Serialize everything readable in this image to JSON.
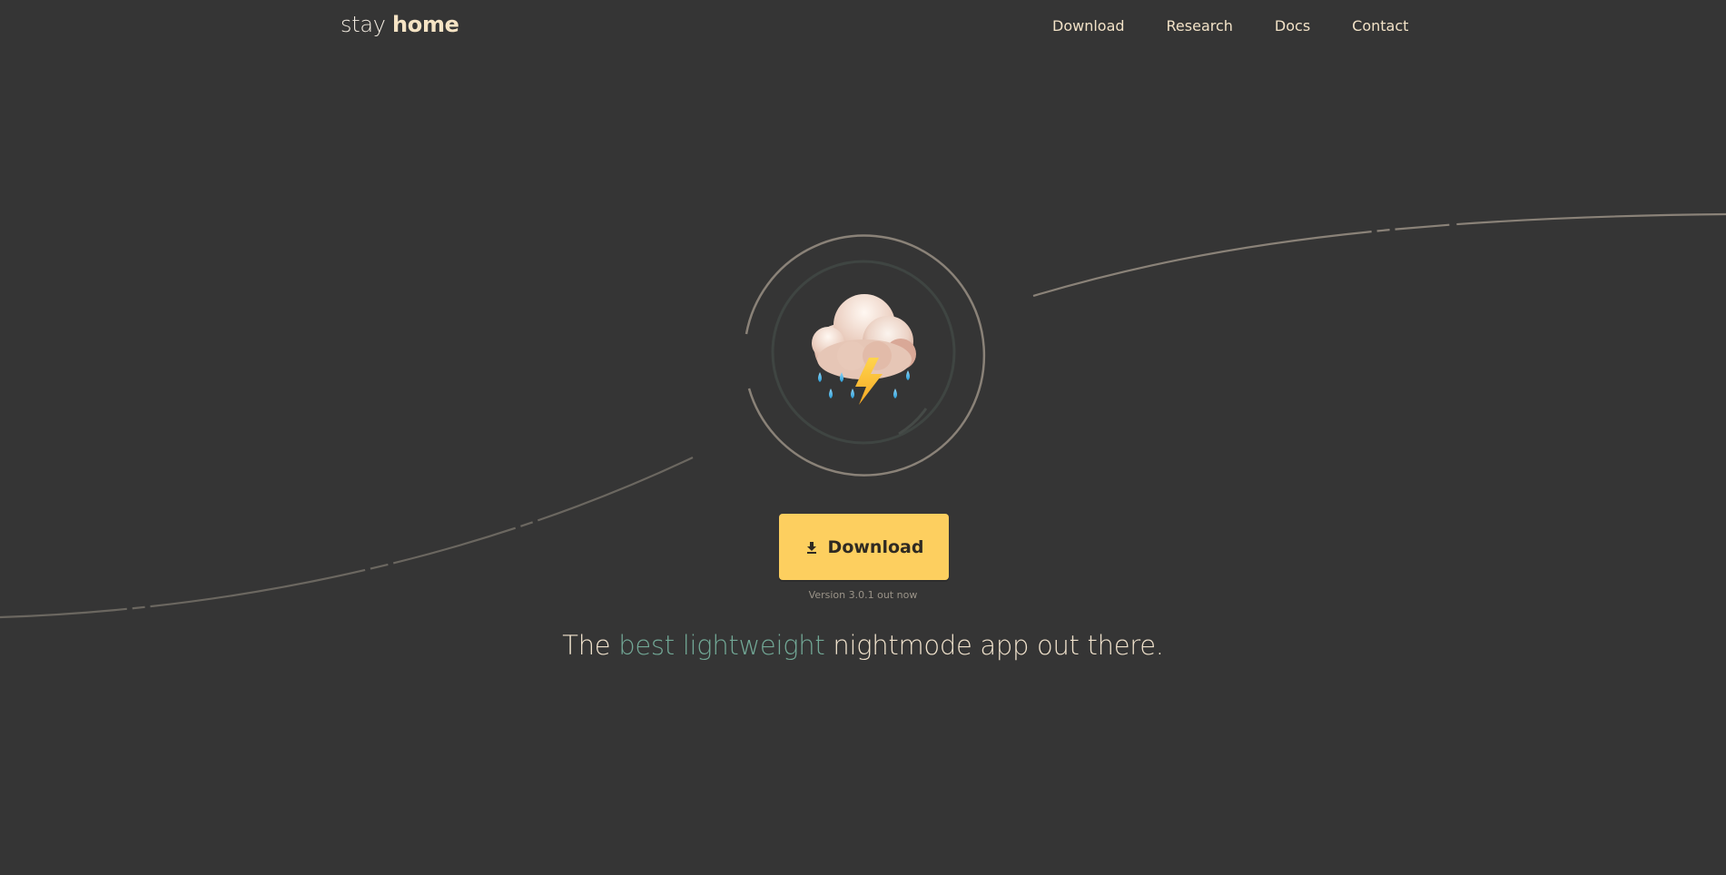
{
  "header": {
    "logo_light": "stay ",
    "logo_bold": "home"
  },
  "nav": {
    "items": [
      "Download",
      "Research",
      "Docs",
      "Contact"
    ]
  },
  "hero": {
    "icon": "cloud-with-lightning-and-rain-icon",
    "download_label": "Download",
    "download_icon": "download-arrow-icon",
    "version_text": "Version 3.0.1 out now",
    "tagline_before": "The ",
    "tagline_accent": "best lightweight",
    "tagline_after": " nightmode app out there."
  },
  "colors": {
    "background": "#353535",
    "accent_yellow": "#fdcf5f",
    "accent_teal": "#72a896",
    "text_cream": "#f2e2c7"
  }
}
